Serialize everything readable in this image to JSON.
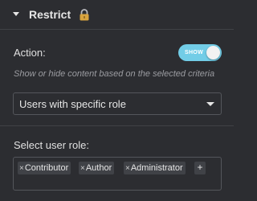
{
  "section": {
    "title": "Restrict",
    "lock_icon": "lock-icon",
    "caret_icon": "caret-down-icon"
  },
  "action": {
    "label": "Action:",
    "toggle_text": "SHOW",
    "toggle_on": true,
    "accent_color": "#72cde7"
  },
  "description": "Show or hide content based on the selected criteria",
  "select": {
    "value": "Users with specific role"
  },
  "roles": {
    "label": "Select user role:",
    "tags": [
      {
        "label": "Contributor",
        "remove": "×"
      },
      {
        "label": "Author",
        "remove": "×"
      },
      {
        "label": "Administrator",
        "remove": "×"
      }
    ],
    "add_symbol": "+"
  }
}
